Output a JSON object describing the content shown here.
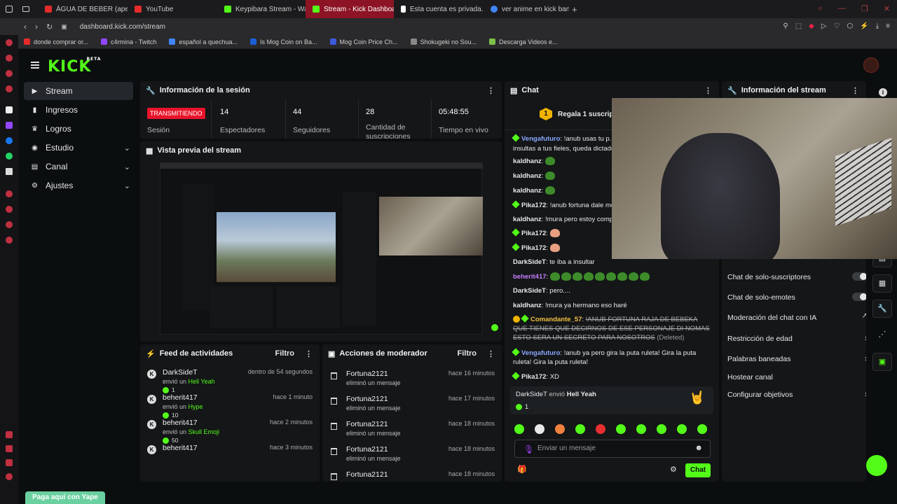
{
  "browser": {
    "tabs": [
      {
        "title": "ÁGUA DE BEBER (apedup",
        "color": "#e62b2b"
      },
      {
        "title": "YouTube",
        "color": "#e62b2b"
      },
      {
        "title": "Keypibara Stream - Watc",
        "color": "#53fc18"
      },
      {
        "title": "Stream - Kick Dashboard",
        "color": "#53fc18"
      },
      {
        "title": "Esta cuenta es privada. S",
        "color": "#ffffff"
      },
      {
        "title": "ver anime en kick baneab",
        "color": "#4285f4"
      }
    ],
    "url": "dashboard.kick.com/stream",
    "bookmarks": [
      {
        "label": "donde comprar or...",
        "color": "#e62b2b"
      },
      {
        "label": "c4rmina - Twitch",
        "color": "#9146ff"
      },
      {
        "label": "español a quechua...",
        "color": "#4285f4"
      },
      {
        "label": "Is Mog Coin on Ba...",
        "color": "#1a5fd8"
      },
      {
        "label": "Mog Coin Price Ch...",
        "color": "#3b5bdb"
      },
      {
        "label": "Shokugeki no Sou...",
        "color": "#888888"
      },
      {
        "label": "Descarga Videos e...",
        "color": "#7cc04a"
      }
    ]
  },
  "kick": {
    "logo": "KICK",
    "logo_sup": "BETA",
    "brand_color": "#53fc18",
    "sidebar": [
      {
        "label": "Stream",
        "icon": "stream-icon",
        "active": true
      },
      {
        "label": "Ingresos",
        "icon": "chart-icon"
      },
      {
        "label": "Logros",
        "icon": "trophy-icon"
      },
      {
        "label": "Estudio",
        "icon": "studio-icon",
        "chevron": true
      },
      {
        "label": "Canal",
        "icon": "channel-icon",
        "chevron": true
      },
      {
        "label": "Ajustes",
        "icon": "gear-icon",
        "chevron": true
      }
    ]
  },
  "session": {
    "title": "Información de la sesión",
    "live_label": "TRANSMITIENDO",
    "session_label": "Sesión",
    "stats": [
      {
        "value": "14",
        "label": "Espectadores"
      },
      {
        "value": "44",
        "label": "Seguidores"
      },
      {
        "value": "28",
        "label": "Cantidad de suscripciones"
      },
      {
        "value": "05:48:55",
        "label": "Tiempo en vivo"
      }
    ]
  },
  "preview": {
    "title": "Vista previa del stream"
  },
  "feed": {
    "title": "Feed de actividades",
    "filter": "Filtro",
    "items": [
      {
        "user": "DarkSideT",
        "action": "envió un",
        "item": "Hell Yeah",
        "when": "dentro de 54 segundos",
        "amount": "1"
      },
      {
        "user": "beherit417",
        "action": "envió un",
        "item": "Hype",
        "when": "hace 1 minuto",
        "amount": "10"
      },
      {
        "user": "beherit417",
        "action": "envió un",
        "item": "Skull Emoji",
        "when": "hace 2 minutos",
        "amount": "50"
      },
      {
        "user": "beherit417",
        "action": "",
        "item": "",
        "when": "hace 3 minutos",
        "amount": ""
      }
    ]
  },
  "mod": {
    "title": "Acciones de moderador",
    "filter": "Filtro",
    "items": [
      {
        "user": "Fortuna2121",
        "action": "eliminó un mensaje",
        "when": "hace 16 minutos"
      },
      {
        "user": "Fortuna2121",
        "action": "eliminó un mensaje",
        "when": "hace 17 minutos"
      },
      {
        "user": "Fortuna2121",
        "action": "eliminó un mensaje",
        "when": "hace 18 minutos"
      },
      {
        "user": "Fortuna2121",
        "action": "eliminó un mensaje",
        "when": "hace 18 minutos"
      },
      {
        "user": "Fortuna2121",
        "action": "",
        "when": "hace 18 minutos"
      }
    ]
  },
  "chat": {
    "title": "Chat",
    "gift_banner": "Regala 1 suscripción",
    "gift_count": "1",
    "messages": [
      {
        "user": "Vengafuturo",
        "text": "!anub usas tu p...",
        "cls": "b",
        "badge": true
      },
      {
        "user": "",
        "text": "insultas a tus fieles, queda dictado",
        "cls": ""
      },
      {
        "user": "kaldhanz",
        "text": "",
        "cls": "",
        "emotes": 1
      },
      {
        "user": "kaldhanz",
        "text": "",
        "cls": "",
        "emotes": 1
      },
      {
        "user": "kaldhanz",
        "text": "",
        "cls": "",
        "emotes": 1
      },
      {
        "user": "Pika172",
        "text": "!anub fortuna dale mo",
        "cls": "",
        "badge": true
      },
      {
        "user": "kaldhanz",
        "text": "!mura pero estoy comp",
        "cls": ""
      },
      {
        "user": "Pika172",
        "text": "",
        "cls": "",
        "badge": true,
        "hand": true
      },
      {
        "user": "Pika172",
        "text": "",
        "cls": "",
        "badge": true,
        "hand": true
      },
      {
        "user": "DarkSideT",
        "text": "te iba a insultar",
        "cls": ""
      },
      {
        "user": "beherit417",
        "text": "",
        "cls": "p",
        "emotes": 9
      },
      {
        "user": "DarkSideT",
        "text": "pero....",
        "cls": ""
      },
      {
        "user": "kaldhanz",
        "text": "!mura ya hermano eso haré",
        "cls": ""
      }
    ],
    "deleted": {
      "user": "Comandante_57",
      "text": "!ANUB FORTUNA RAJA DE BEBEKA QUE TIENES QUE DECIRNOS DE ESE PERSONAJE DI NOMAS ESTO SERA UN SECRETO PARA NOSOTROS",
      "tag": "(Deleted)"
    },
    "after": [
      {
        "user": "Vengafuturo",
        "text": "!anub ya pero gira la puta ruleta! Gira la puta ruleta! Gira la puta ruleta!",
        "cls": "b",
        "badge": true
      },
      {
        "user": "Pika172",
        "text": "XD",
        "cls": "",
        "badge": true
      }
    ],
    "gift_event": {
      "user": "DarkSideT",
      "action": "envió",
      "item": "Hell Yeah",
      "amount": "1"
    },
    "input_placeholder": "Enviar un mensaje",
    "send_label": "Chat"
  },
  "stream_info": {
    "title": "Información del stream",
    "settings": [
      {
        "label": "Chat de solo-suscriptores",
        "type": "toggle"
      },
      {
        "label": "Chat de solo-emotes",
        "type": "toggle"
      },
      {
        "label": "Moderación del chat con IA",
        "type": "external"
      },
      {
        "label": "Restricción de edad",
        "type": "arrow"
      },
      {
        "label": "Palabras baneadas",
        "type": "arrow"
      },
      {
        "label": "Hostear canal",
        "type": "none"
      },
      {
        "label": "Configurar objetivos",
        "type": "arrow"
      }
    ]
  },
  "yape": {
    "label": "Paga aquí con Yape"
  }
}
